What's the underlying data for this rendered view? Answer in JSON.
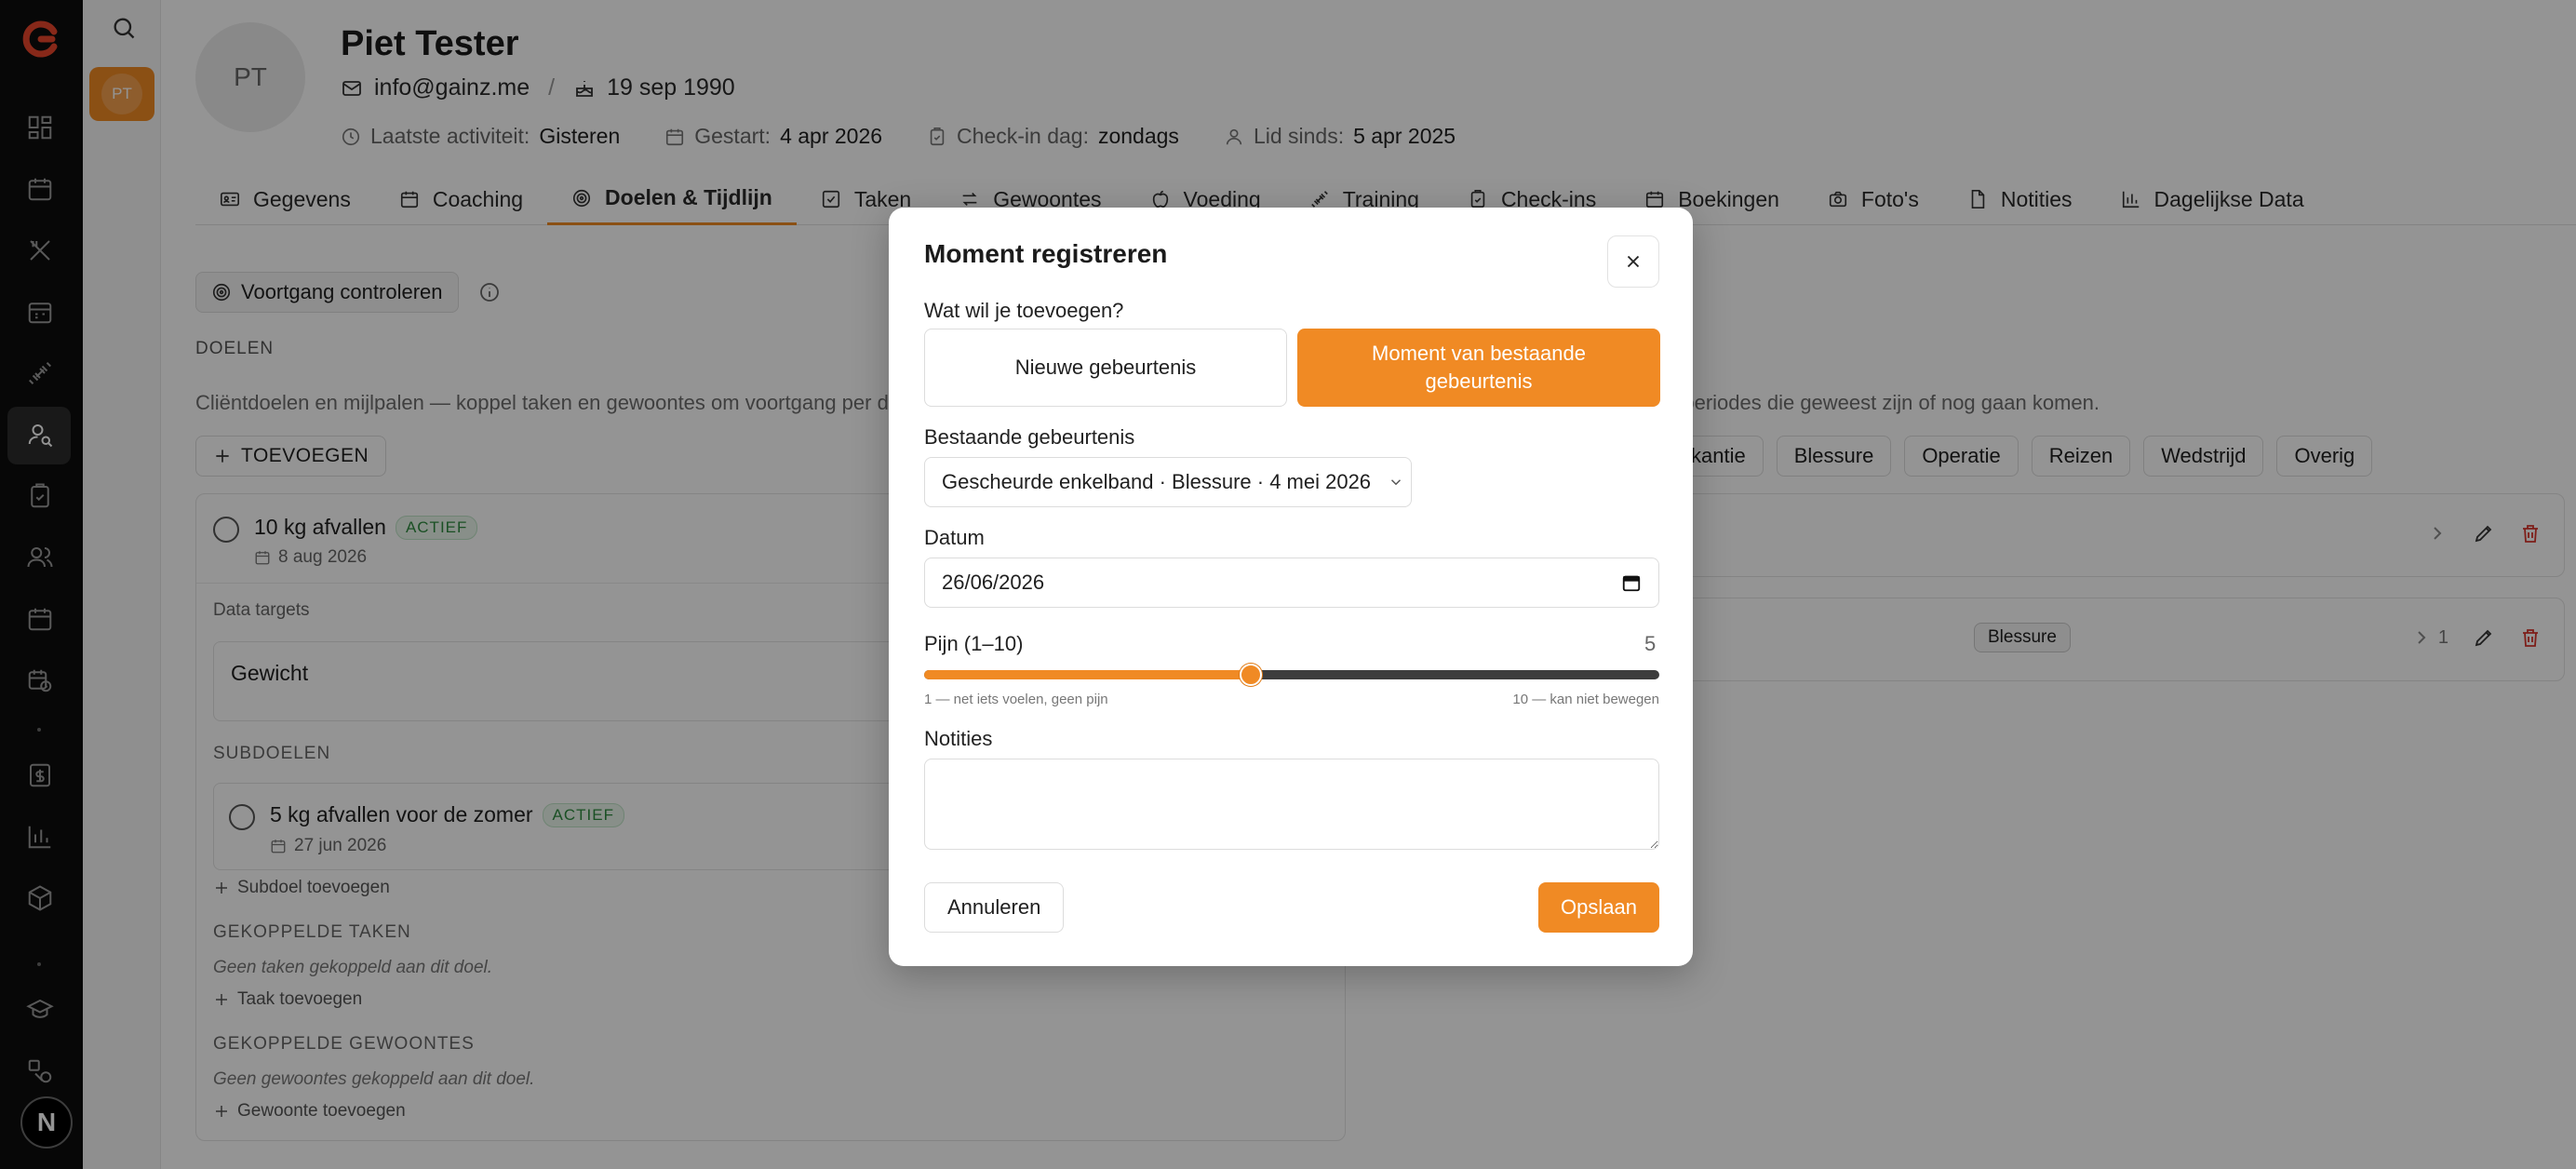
{
  "brand": {
    "accent": "#f08a24",
    "rail_bg": "#0d0d0d"
  },
  "rail": {
    "icons": [
      "dashboard-icon",
      "calendar-icon",
      "utensils-icon",
      "calendar-grid-icon",
      "dumbbell-icon",
      "user-search-icon",
      "clipboard-check-icon",
      "users-icon",
      "calendar-icon",
      "calendar-clock-icon",
      "invoice-icon",
      "bar-chart-icon",
      "package-icon",
      "graduation-cap-icon",
      "shapes-icon"
    ],
    "bottom_badge": "N"
  },
  "rail2": {
    "avatar_initials": "PT"
  },
  "client": {
    "initials": "PT",
    "name": "Piet Tester",
    "email": "info@gainz.me",
    "separator": "/",
    "birthdate": "19 sep 1990",
    "last_activity_label": "Laatste activiteit:",
    "last_activity": "Gisteren",
    "started_label": "Gestart:",
    "started": "4 apr 2026",
    "checkin_label": "Check-in dag:",
    "checkin": "zondags",
    "member_label": "Lid sinds:",
    "member": "5 apr 2025"
  },
  "tabs": [
    {
      "label": "Gegevens",
      "icon": "id-card-icon"
    },
    {
      "label": "Coaching",
      "icon": "calendar-icon"
    },
    {
      "label": "Doelen & Tijdlijn",
      "icon": "target-icon",
      "active": true
    },
    {
      "label": "Taken",
      "icon": "checkbox-icon"
    },
    {
      "label": "Gewoontes",
      "icon": "repeat-icon"
    },
    {
      "label": "Voeding",
      "icon": "apple-icon"
    },
    {
      "label": "Training",
      "icon": "dumbbell-icon"
    },
    {
      "label": "Check-ins",
      "icon": "clipboard-check-icon"
    },
    {
      "label": "Boekingen",
      "icon": "calendar-icon"
    },
    {
      "label": "Foto's",
      "icon": "camera-icon"
    },
    {
      "label": "Notities",
      "icon": "file-icon"
    },
    {
      "label": "Dagelijkse Data",
      "icon": "bar-chart-icon"
    }
  ],
  "goals": {
    "progress_button": "Voortgang controleren",
    "section_title": "DOELEN",
    "description": "Cliëntdoelen en mijlpalen — koppel taken en gewoontes om voortgang per do",
    "add_button": "TOEVOEGEN",
    "goal": {
      "title": "10 kg afvallen",
      "status": "ACTIEF",
      "date": "8 aug 2026",
      "data_targets_label": "Data targets",
      "target": "Gewicht",
      "subgoals_label": "SUBDOELEN",
      "subgoal_title": "5 kg afvallen voor de zomer",
      "subgoal_status": "ACTIEF",
      "subgoal_date": "27 jun 2026",
      "add_subgoal": "Subdoel toevoegen",
      "linked_tasks_label": "GEKOPPELDE TAKEN",
      "linked_tasks_empty": "Geen taken gekoppeld aan dit doel.",
      "add_task": "Taak toevoegen",
      "linked_habits_label": "GEKOPPELDE GEWOONTES",
      "linked_habits_empty": "Geen gewoontes gekoppeld aan dit doel.",
      "add_habit": "Gewoonte toevoegen"
    }
  },
  "timeline": {
    "description": "n/periodes die geweest zijn of nog gaan komen.",
    "filters": [
      "kantie",
      "Blessure",
      "Operatie",
      "Reizen",
      "Wedstrijd",
      "Overig"
    ],
    "event2_chip": "Blessure",
    "event2_count": "1"
  },
  "modal": {
    "title": "Moment registreren",
    "question": "Wat wil je toevoegen?",
    "option_new": "Nieuwe gebeurtenis",
    "option_existing": "Moment van bestaande gebeurtenis",
    "existing_label": "Bestaande gebeurtenis",
    "existing_value": "Gescheurde enkelband · Blessure · 4 mei 2026",
    "date_label": "Datum",
    "date_value": "26/06/2026",
    "pain_label": "Pijn (1–10)",
    "pain_min": 1,
    "pain_max": 10,
    "pain_value": 5,
    "pain_value_text": "5",
    "pain_min_label": "1 — net iets voelen, geen pijn",
    "pain_max_label": "10 — kan niet bewegen",
    "notes_label": "Notities",
    "notes_value": "",
    "cancel": "Annuleren",
    "save": "Opslaan"
  }
}
